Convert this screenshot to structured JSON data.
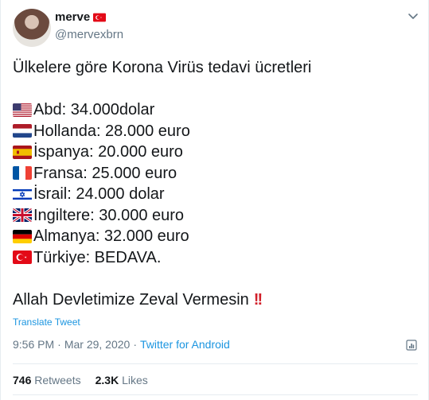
{
  "user": {
    "name": "merve",
    "handle": "@mervexbrn"
  },
  "tweet": {
    "title": "Ülkelere göre Korona Virüs tedavi ücretleri",
    "items": [
      {
        "flag": "us-flag",
        "text": "Abd: 34.000dolar"
      },
      {
        "flag": "netherlands-flag",
        "text": "Hollanda: 28.000 euro"
      },
      {
        "flag": "spain-flag",
        "text": "İspanya: 20.000 euro"
      },
      {
        "flag": "france-flag",
        "text": "Fransa: 25.000 euro"
      },
      {
        "flag": "israel-flag",
        "text": "İsrail: 24.000 dolar"
      },
      {
        "flag": "uk-flag",
        "text": "Ingiltere: 30.000 euro"
      },
      {
        "flag": "germany-flag",
        "text": "Almanya: 32.000 euro"
      },
      {
        "flag": "turkey-flag",
        "text": "Türkiye: BEDAVA."
      }
    ],
    "closing": "Allah Devletimize Zeval Vermesin",
    "closing_emoji": "!!"
  },
  "translate_label": "Translate Tweet",
  "meta": {
    "time": "9:56 PM",
    "date": "Mar 29, 2020",
    "separator": "·",
    "source": "Twitter for Android"
  },
  "stats": {
    "retweets_count": "746",
    "retweets_label": "Retweets",
    "likes_count": "2.3K",
    "likes_label": "Likes"
  },
  "colors": {
    "link": "#1b95e0",
    "muted": "#657786",
    "text": "#14171a",
    "border": "#e6ecf0"
  }
}
